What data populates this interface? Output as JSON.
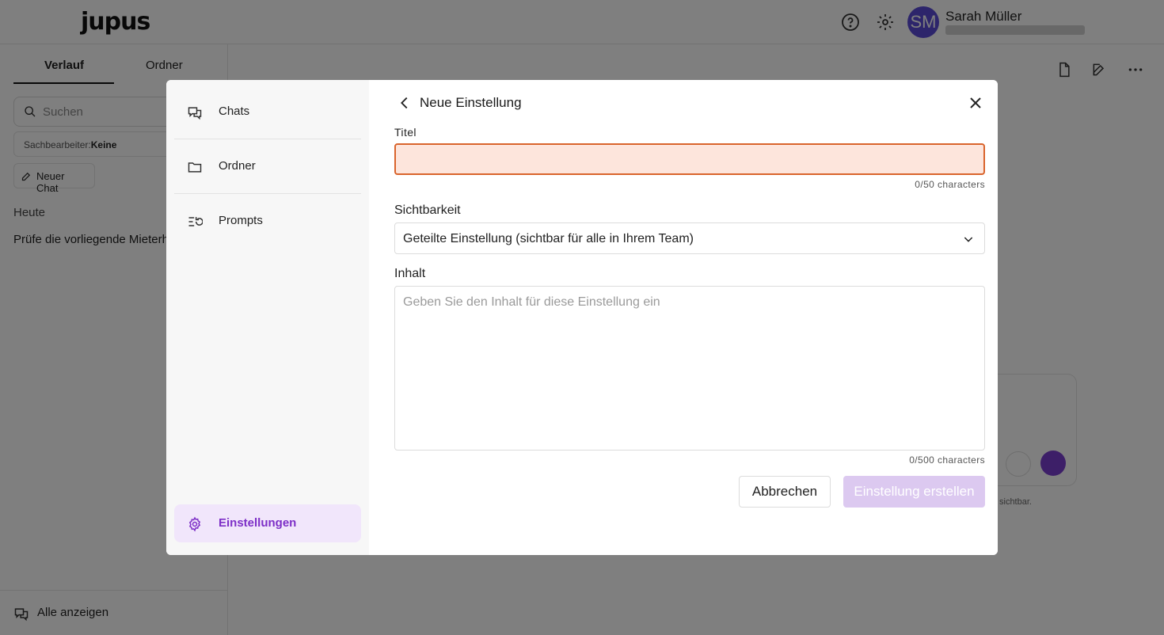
{
  "app": {
    "logo": "jupus",
    "user": {
      "initials": "SM",
      "name": "Sarah Müller"
    }
  },
  "sidebar": {
    "tabs": [
      "Verlauf",
      "Ordner"
    ],
    "search_placeholder": "Suchen",
    "filter_label": "Sachbearbeiter:",
    "filter_value": "Keine",
    "new_chat_label": "Neuer Chat",
    "section_today": "Heute",
    "chats": [
      "Prüfe die vorliegende Mieterhöhung"
    ],
    "show_all": "Alle anzeigen"
  },
  "main": {
    "disclaimer_fragment": "sichtbar."
  },
  "modal": {
    "nav": [
      {
        "label": "Chats",
        "icon": "chats-icon"
      },
      {
        "label": "Ordner",
        "icon": "folder-icon"
      },
      {
        "label": "Prompts",
        "icon": "prompts-icon"
      }
    ],
    "nav_active": {
      "label": "Einstellungen",
      "icon": "gear-icon"
    },
    "title": "Neue Einstellung",
    "title_field": {
      "label": "Titel",
      "value": "",
      "counter": "0/50 characters"
    },
    "visibility": {
      "label": "Sichtbarkeit",
      "selected": "Geteilte Einstellung (sichtbar für alle in Ihrem Team)"
    },
    "content": {
      "label": "Inhalt",
      "placeholder": "Geben Sie den Inhalt für diese Einstellung ein",
      "counter": "0/500 characters"
    },
    "buttons": {
      "cancel": "Abbrechen",
      "create": "Einstellung erstellen"
    }
  },
  "colors": {
    "accent": "#7d2fc7",
    "error_border": "#d9642c",
    "error_bg": "#fde5dc",
    "disabled_button": "#dcc9f0"
  }
}
